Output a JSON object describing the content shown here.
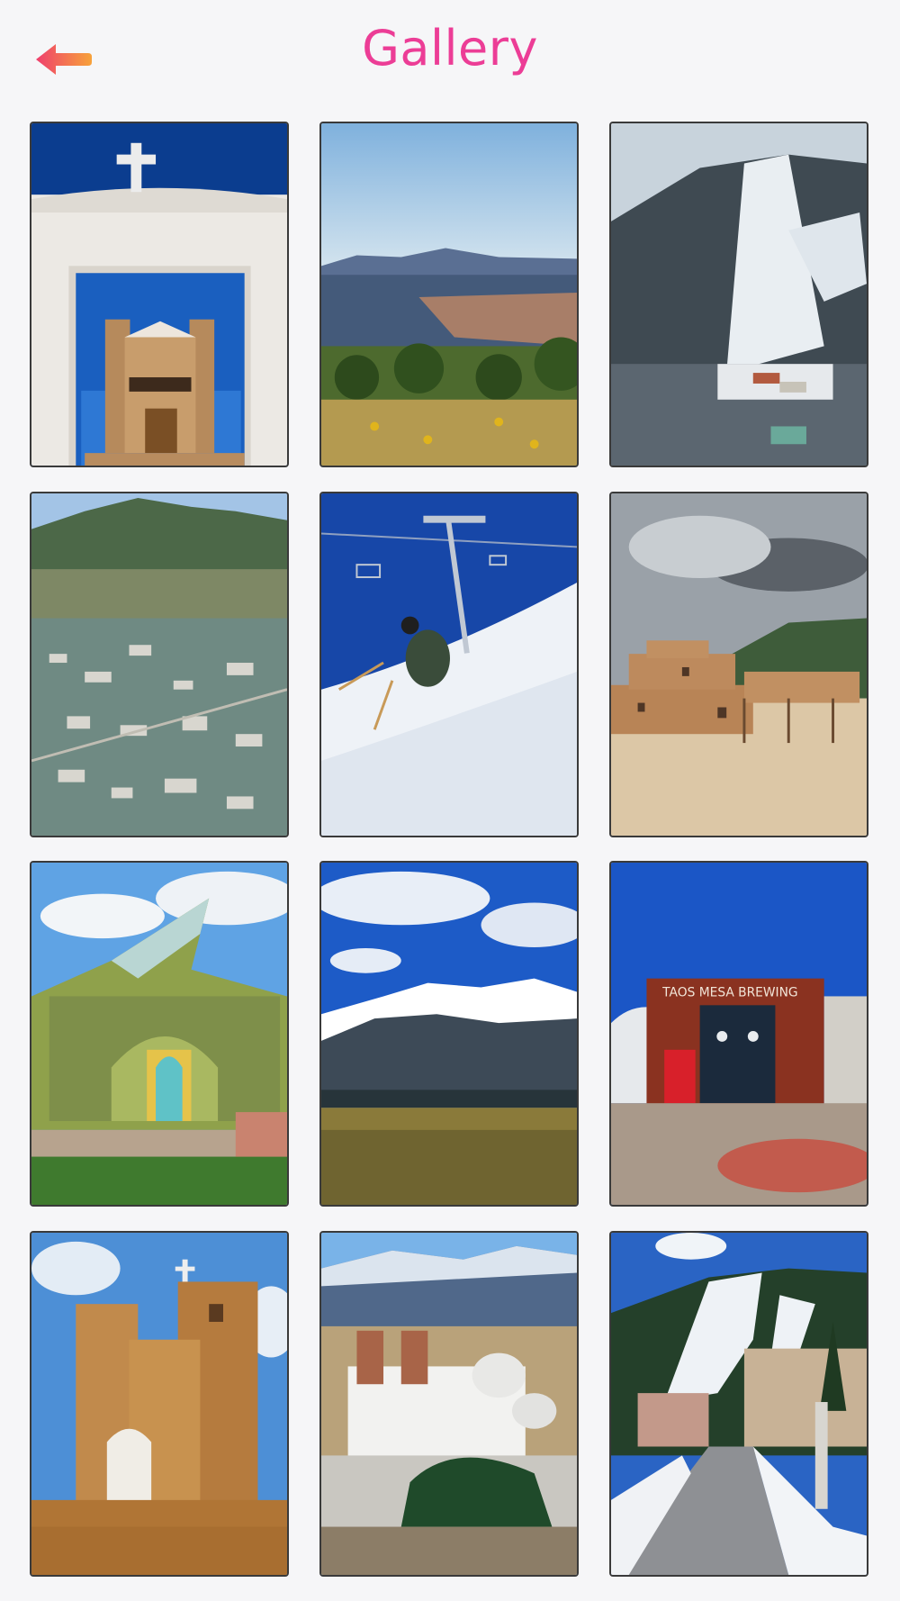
{
  "header": {
    "title": "Gallery",
    "back_icon": "back-arrow-icon"
  },
  "gallery": {
    "items": [
      {
        "name": "mission-church-cross-photo"
      },
      {
        "name": "rio-grande-gorge-photo"
      },
      {
        "name": "snowy-ski-mountain-photo"
      },
      {
        "name": "aerial-town-view-photo"
      },
      {
        "name": "skier-chairlift-photo"
      },
      {
        "name": "adobe-pueblo-photo"
      },
      {
        "name": "earthship-house-photo"
      },
      {
        "name": "snowcapped-mountain-field-photo"
      },
      {
        "name": "brewing-building-photo"
      },
      {
        "name": "adobe-church-photo"
      },
      {
        "name": "white-church-mountains-photo"
      },
      {
        "name": "ski-resort-village-photo"
      }
    ],
    "brewery_sign": "TAOS MESA BREWING"
  },
  "colors": {
    "accent": "#ec3d96",
    "back_arrow": "#f26a2e",
    "background": "#f6f6f8"
  }
}
